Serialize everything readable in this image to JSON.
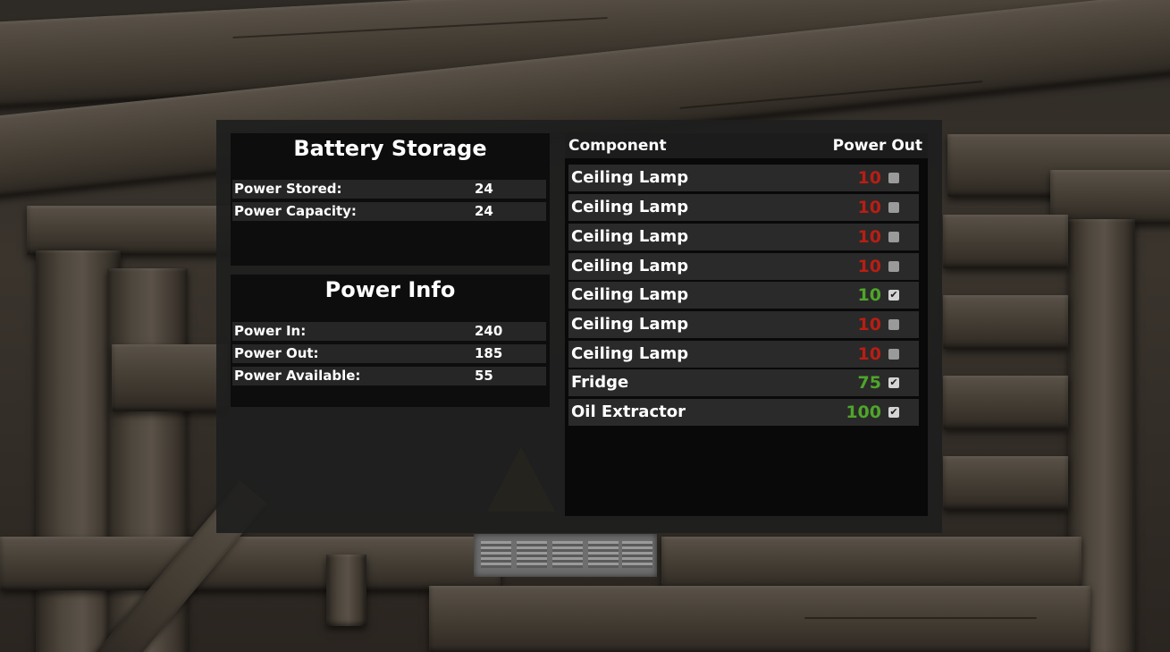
{
  "battery_storage": {
    "title": "Battery Storage",
    "rows": [
      {
        "label": "Power Stored:",
        "value": "24"
      },
      {
        "label": "Power Capacity:",
        "value": "24"
      }
    ]
  },
  "power_info": {
    "title": "Power Info",
    "rows": [
      {
        "label": "Power In:",
        "value": "240"
      },
      {
        "label": "Power Out:",
        "value": "185"
      },
      {
        "label": "Power Available:",
        "value": "55"
      }
    ]
  },
  "components": {
    "header": {
      "component": "Component",
      "power_out": "Power Out"
    },
    "rows": [
      {
        "name": "Ceiling Lamp",
        "power": "10",
        "enabled": false
      },
      {
        "name": "Ceiling Lamp",
        "power": "10",
        "enabled": false
      },
      {
        "name": "Ceiling Lamp",
        "power": "10",
        "enabled": false
      },
      {
        "name": "Ceiling Lamp",
        "power": "10",
        "enabled": false
      },
      {
        "name": "Ceiling Lamp",
        "power": "10",
        "enabled": true
      },
      {
        "name": "Ceiling Lamp",
        "power": "10",
        "enabled": false
      },
      {
        "name": "Ceiling Lamp",
        "power": "10",
        "enabled": false
      },
      {
        "name": "Fridge",
        "power": "75",
        "enabled": true
      },
      {
        "name": "Oil Extractor",
        "power": "100",
        "enabled": true
      }
    ]
  },
  "colors": {
    "power_on": "#4fa52a",
    "power_off": "#b81e14"
  },
  "icons": {
    "checkbox_checked": "check-icon"
  }
}
